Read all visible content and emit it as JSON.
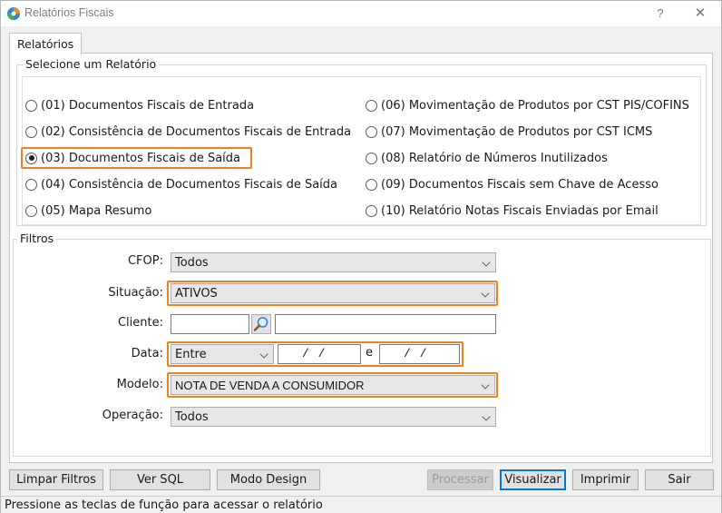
{
  "window": {
    "title": "Relatórios Fiscais",
    "help": "?",
    "close": "✕"
  },
  "tabs": [
    {
      "label": "Relatórios"
    }
  ],
  "select_group": {
    "title": "Selecione um Relatório",
    "options_left": [
      {
        "label": "(01) Documentos Fiscais de Entrada",
        "checked": false
      },
      {
        "label": "(02) Consistência de Documentos Fiscais de Entrada",
        "checked": false
      },
      {
        "label": "(03) Documentos Fiscais de Saída",
        "checked": true
      },
      {
        "label": "(04) Consistência de Documentos Fiscais de Saída",
        "checked": false
      },
      {
        "label": "(05) Mapa Resumo",
        "checked": false
      }
    ],
    "options_right": [
      {
        "label": "(06) Movimentação de Produtos por CST PIS/COFINS",
        "checked": false
      },
      {
        "label": "(07) Movimentação de Produtos por CST ICMS",
        "checked": false
      },
      {
        "label": "(08) Relatório de Números Inutilizados",
        "checked": false
      },
      {
        "label": "(09) Documentos Fiscais sem Chave de Acesso",
        "checked": false
      },
      {
        "label": "(10) Relatório Notas Fiscais Enviadas por Email",
        "checked": false
      }
    ]
  },
  "filters": {
    "title": "Filtros",
    "cfop": {
      "label": "CFOP:",
      "value": "Todos"
    },
    "situacao": {
      "label": "Situação:",
      "value": "ATIVOS"
    },
    "cliente": {
      "label": "Cliente:",
      "code": "",
      "name": ""
    },
    "data": {
      "label": "Data:",
      "mode": "Entre",
      "from": "/ /",
      "sep": "e",
      "to": "/ /"
    },
    "modelo": {
      "label": "Modelo:",
      "value": "NOTA DE VENDA A CONSUMIDOR"
    },
    "operacao": {
      "label": "Operação:",
      "value": "Todos"
    }
  },
  "buttons": {
    "limpar": "Limpar Filtros",
    "sql": "Ver SQL",
    "design": "Modo Design",
    "processar": "Processar",
    "visualizar": "Visualizar",
    "imprimir": "Imprimir",
    "sair": "Sair"
  },
  "status": "Pressione as teclas de função para acessar o relatório",
  "colors": {
    "highlight": "#f07f1e",
    "focus": "#0078d7"
  }
}
